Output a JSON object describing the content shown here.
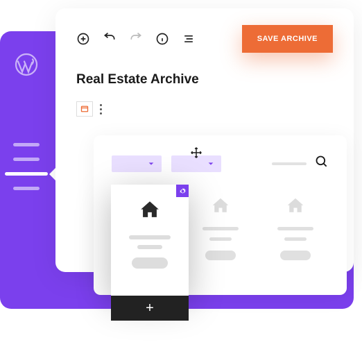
{
  "header": {
    "save_label": "SAVE ARCHIVE"
  },
  "page": {
    "title": "Real Estate Archive"
  },
  "add_bar": {
    "label": "+"
  },
  "colors": {
    "primary": "#7b40ed",
    "accent": "#ed6c36"
  }
}
